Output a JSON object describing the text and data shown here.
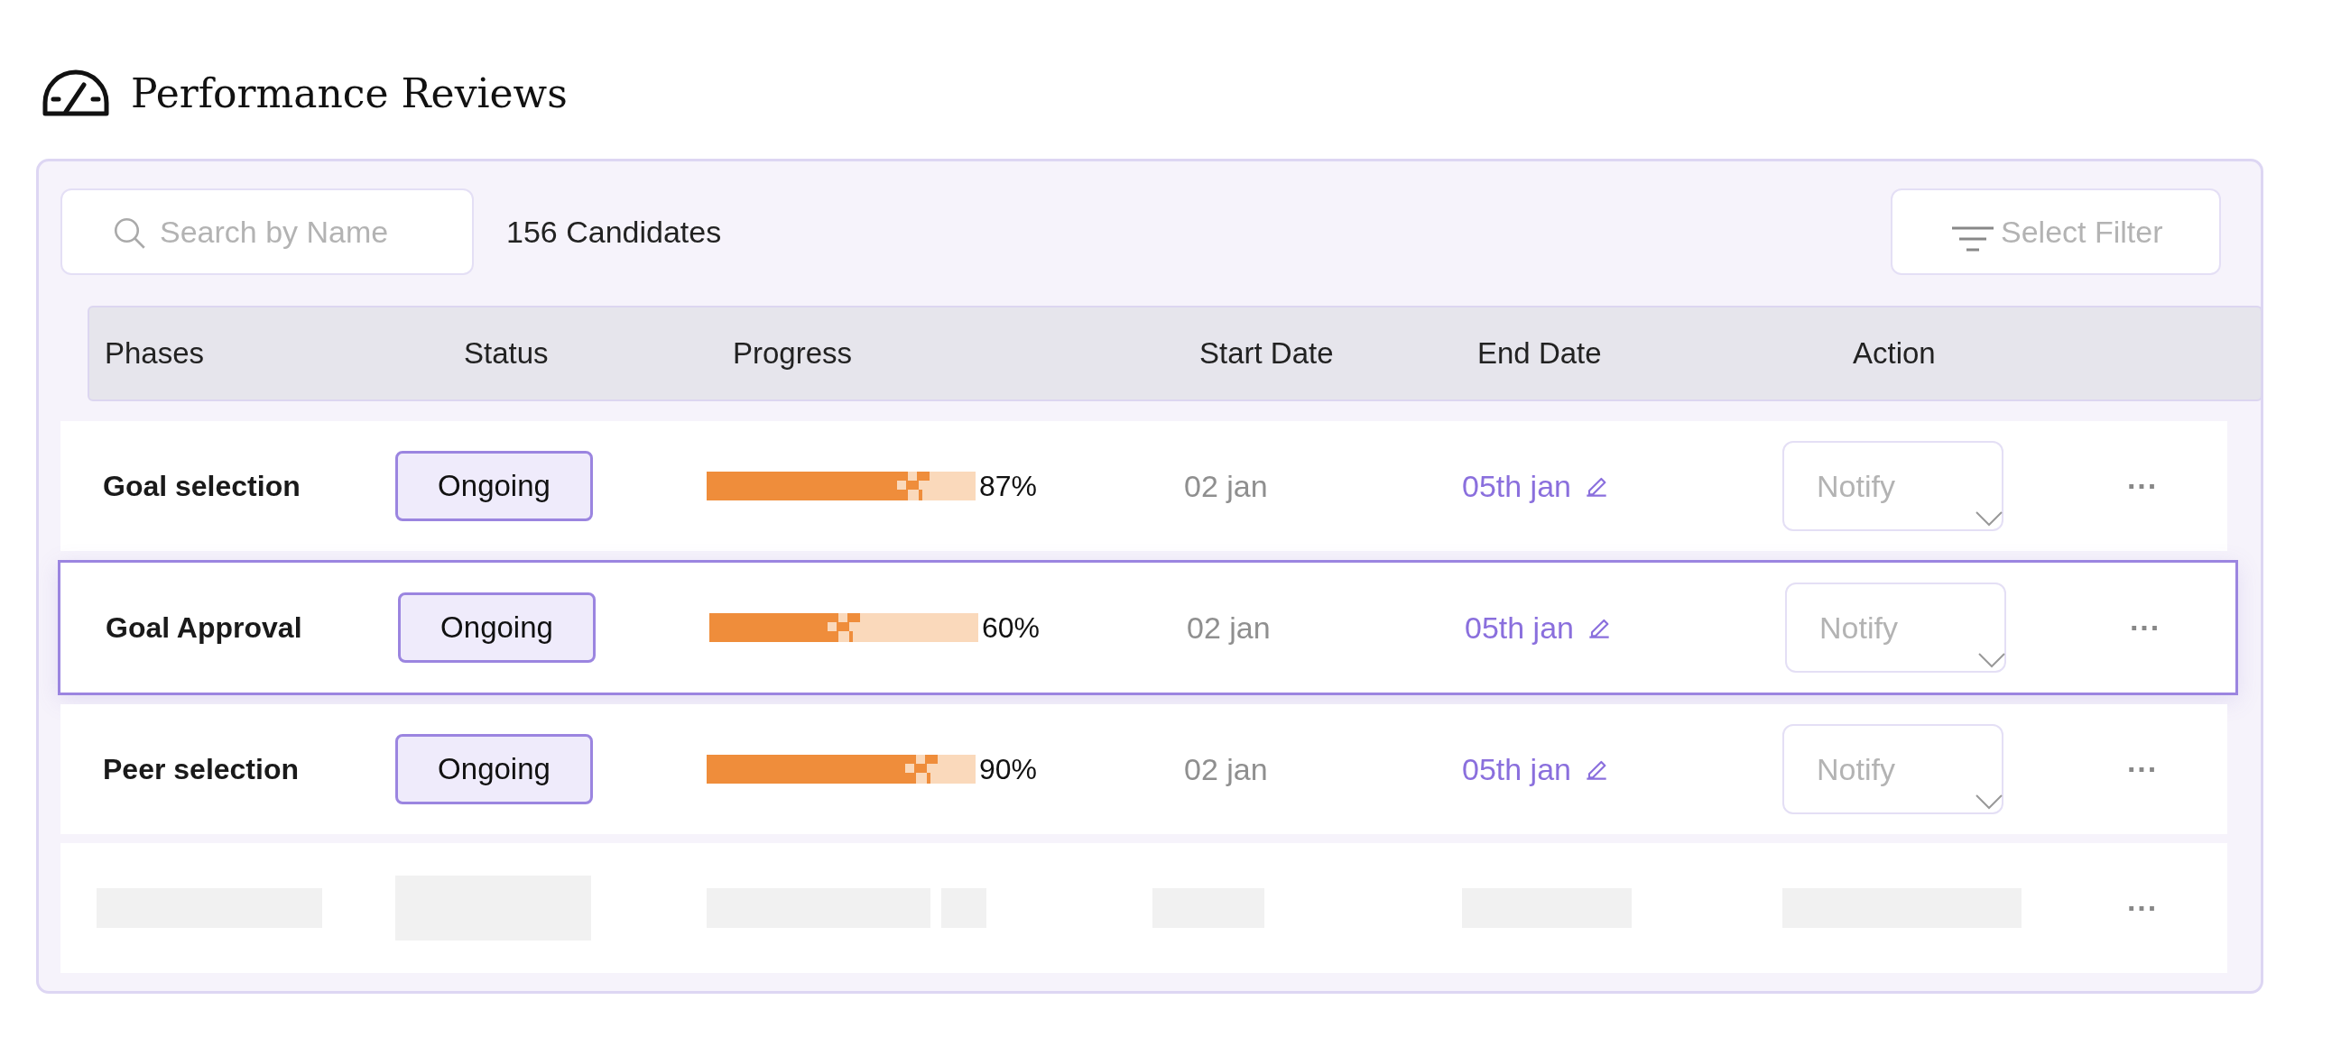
{
  "page": {
    "title": "Performance Reviews"
  },
  "toolbar": {
    "search": {
      "placeholder": "Search by Name"
    },
    "count": "156 Candidates",
    "filter": {
      "placeholder": "Select Filter"
    }
  },
  "table": {
    "columns": [
      "Phases",
      "Status",
      "Progress",
      "Start Date",
      "End Date",
      "Action"
    ],
    "rows": [
      {
        "kind": "phase",
        "selected": false,
        "phase": "Goal selection",
        "status": "Ongoing",
        "level": 0.87,
        "reading": "87%",
        "start": "02 jan",
        "end": "05th jan",
        "action": {
          "placeholder": "Notify"
        },
        "more": "···"
      },
      {
        "kind": "phase",
        "selected": true,
        "phase": "Goal Approval",
        "status": "Ongoing",
        "level": 0.6,
        "reading": "60%",
        "start": "02 jan",
        "end": "05th jan",
        "action": {
          "placeholder": "Notify"
        },
        "more": "···"
      },
      {
        "kind": "phase",
        "selected": false,
        "phase": "Peer selection",
        "status": "Ongoing",
        "level": 0.9,
        "reading": "90%",
        "start": "02 jan",
        "end": "05th jan",
        "action": {
          "placeholder": "Notify"
        },
        "more": "···"
      },
      {
        "kind": "loading",
        "selected": false,
        "more": "···"
      }
    ]
  }
}
